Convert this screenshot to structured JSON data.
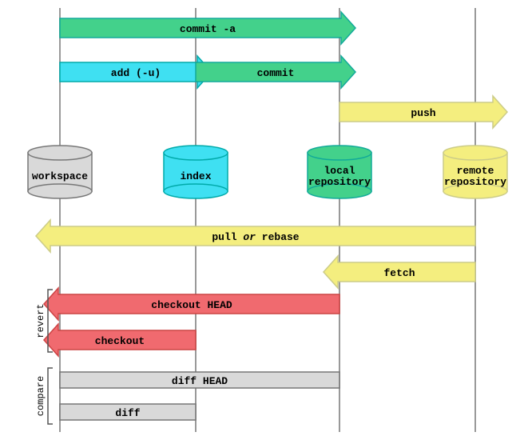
{
  "stages": {
    "workspace": {
      "label": "workspace",
      "fill": "#d9d9d9",
      "stroke": "#777"
    },
    "index": {
      "label": "index",
      "fill": "#3fe0f2",
      "stroke": "#0aa"
    },
    "local": {
      "label": "local repository",
      "fill": "#43d18b",
      "stroke": "#1a9"
    },
    "remote": {
      "label": "remote repository",
      "fill": "#f4ee7f",
      "stroke": "#cc8"
    }
  },
  "arrows": {
    "commit_a": {
      "label": "commit -a",
      "fill": "#43d18b",
      "stroke": "#1a9"
    },
    "add_u": {
      "label": "add (-u)",
      "fill": "#3fe0f2",
      "stroke": "#0aa"
    },
    "commit": {
      "label": "commit",
      "fill": "#43d18b",
      "stroke": "#1a9"
    },
    "push": {
      "label": "push",
      "fill": "#f4ee7f",
      "stroke": "#cc8"
    },
    "pull_rebase": {
      "label_pre": "pull ",
      "label_mid": "or",
      "label_post": " rebase",
      "fill": "#f4ee7f",
      "stroke": "#cc8"
    },
    "fetch": {
      "label": "fetch",
      "fill": "#f4ee7f",
      "stroke": "#cc8"
    },
    "checkout_head": {
      "label": "checkout HEAD",
      "fill": "#f06a6f",
      "stroke": "#c44"
    },
    "checkout": {
      "label": "checkout",
      "fill": "#f06a6f",
      "stroke": "#c44"
    },
    "diff_head": {
      "label": "diff HEAD",
      "fill": "#d9d9d9",
      "stroke": "#777"
    },
    "diff": {
      "label": "diff",
      "fill": "#d9d9d9",
      "stroke": "#777"
    }
  },
  "sections": {
    "revert": "revert",
    "compare": "compare"
  }
}
